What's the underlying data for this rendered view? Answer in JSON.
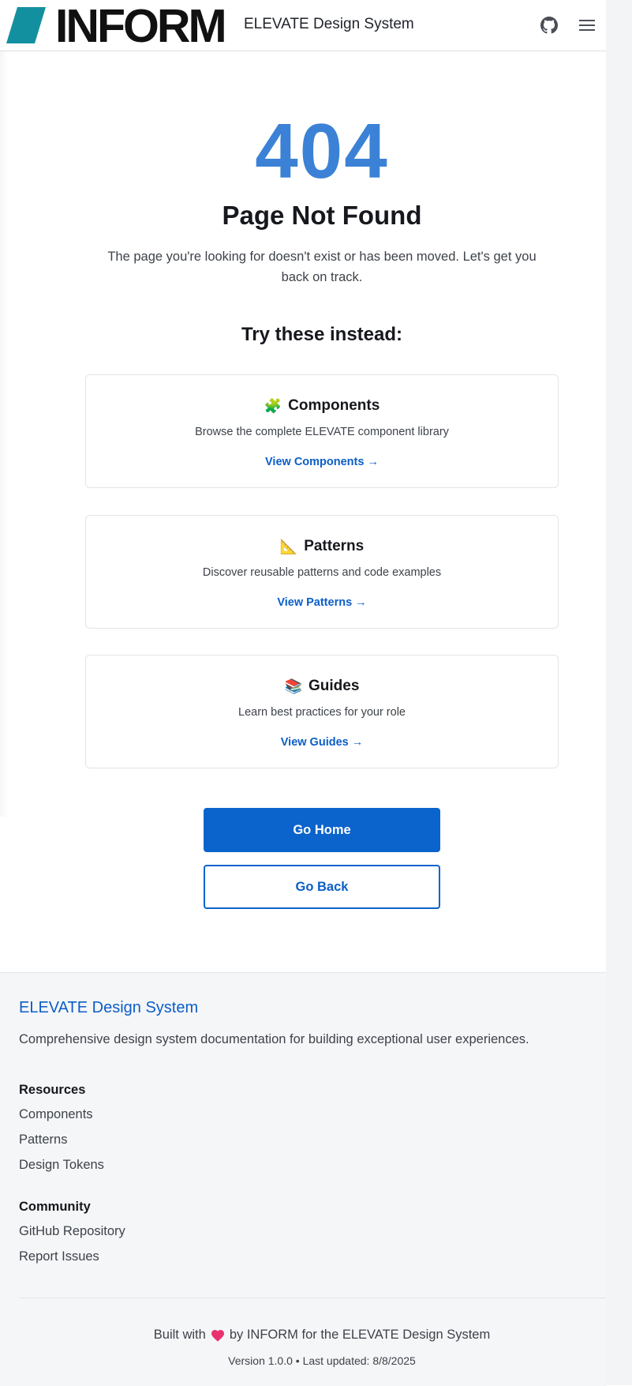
{
  "header": {
    "logo_text": "INFORM",
    "site_title": "ELEVATE Design System",
    "github_icon": "github-icon",
    "menu_icon": "hamburger-menu-icon"
  },
  "main": {
    "code": "404",
    "title": "Page Not Found",
    "description": "The page you're looking for doesn't exist or has been moved. Let's get you back on track.",
    "suggestions_title": "Try these instead:",
    "cards": [
      {
        "icon": "🧩",
        "icon_name": "puzzle-icon",
        "title": "Components",
        "description": "Browse the complete ELEVATE component library",
        "link": "View Components →"
      },
      {
        "icon": "📐",
        "icon_name": "triangular-ruler-icon",
        "title": "Patterns",
        "description": "Discover reusable patterns and code examples",
        "link": "View Patterns →"
      },
      {
        "icon": "📚",
        "icon_name": "books-icon",
        "title": "Guides",
        "description": "Learn best practices for your role",
        "link": "View Guides →"
      }
    ],
    "home_button": "Go Home",
    "back_button": "Go Back"
  },
  "footer": {
    "brand": "ELEVATE Design System",
    "description": "Comprehensive design system documentation for building exceptional user experiences.",
    "resources_heading": "Resources",
    "resources": [
      "Components",
      "Patterns",
      "Design Tokens"
    ],
    "community_heading": "Community",
    "community": [
      "GitHub Repository",
      "Report Issues"
    ],
    "built_prefix": "Built with",
    "built_suffix": "by INFORM for the ELEVATE Design System",
    "version": "Version 1.0.0 • Last updated: 8/8/2025"
  },
  "colors": {
    "accent": "#0b63cc",
    "code404": "#3b82d6",
    "logo_mark": "#1390a0",
    "heart": "#e8336e"
  }
}
